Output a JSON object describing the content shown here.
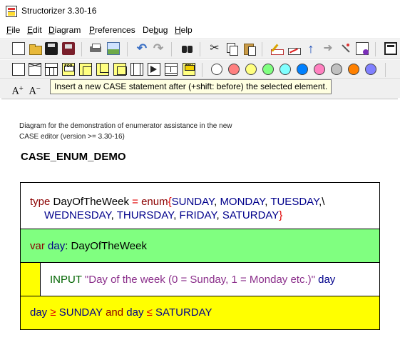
{
  "window": {
    "title": "Structorizer 3.30-16"
  },
  "menubar": {
    "items": [
      {
        "key": "F",
        "rest": "ile"
      },
      {
        "key": "E",
        "rest": "dit"
      },
      {
        "key": "D",
        "rest": "iagram"
      },
      {
        "key": "P",
        "rest": "references"
      },
      {
        "pre": "De",
        "key": "b",
        "rest": "ug"
      },
      {
        "key": "H",
        "rest": "elp"
      }
    ]
  },
  "toolbar": {
    "row1_icons": [
      "new-document-icon",
      "open-folder-icon",
      "save-icon",
      "save-as-icon",
      "print-icon",
      "export-image-icon",
      "undo-icon",
      "redo-icon",
      "find-icon",
      "cut-icon",
      "copy-icon",
      "paste-icon",
      "edit-element-icon",
      "delete-element-icon",
      "move-up-icon",
      "move-down-icon",
      "transmute-icon",
      "comment-icon",
      "window-icon"
    ],
    "row2_labels": {
      "for": "FOR",
      "try": "TRY"
    },
    "colors": [
      "#ffffff",
      "#ff8080",
      "#ffff80",
      "#80ff80",
      "#80ffff",
      "#0080ff",
      "#ff80c0",
      "#c0c0c0",
      "#ff8000",
      "#8080ff"
    ],
    "font_up": "A",
    "font_down": "A"
  },
  "tooltip": {
    "text": "Insert a new CASE statement after (+shift: before) the selected element."
  },
  "diagram": {
    "comment_line1": "Diagram for the demonstration of enumerator assistance in the new",
    "comment_line2": "CASE editor (version >= 3.30-16)",
    "name": "CASE_ENUM_DEMO",
    "type_line1": {
      "kw": "type",
      "name": "DayOfTheWeek",
      "eq": "=",
      "enum": "enum",
      "open": "{",
      "v1": "SUNDAY",
      "c1": ", ",
      "v2": "MONDAY",
      "c2": ", ",
      "v3": "TUESDAY",
      "tail": ",\\"
    },
    "type_line2": {
      "v4": "WEDNESDAY",
      "c4": ", ",
      "v5": "THURSDAY",
      "c5": ", ",
      "v6": "FRIDAY",
      "c6": ", ",
      "v7": "SATURDAY",
      "close": "}"
    },
    "var_line": {
      "kw": "var",
      "name": "day",
      "colon": ": ",
      "type": "DayOfTheWeek"
    },
    "input_line": {
      "kw": "INPUT",
      "prompt": "\"Day of the week (0 = Sunday, 1 = Monday etc.)\"",
      "var": "day"
    },
    "cond_line": {
      "var1": "day",
      "op1": "≥",
      "v1": "SUNDAY",
      "and": "and",
      "var2": "day",
      "op2": "≤",
      "v2": "SATURDAY"
    }
  }
}
